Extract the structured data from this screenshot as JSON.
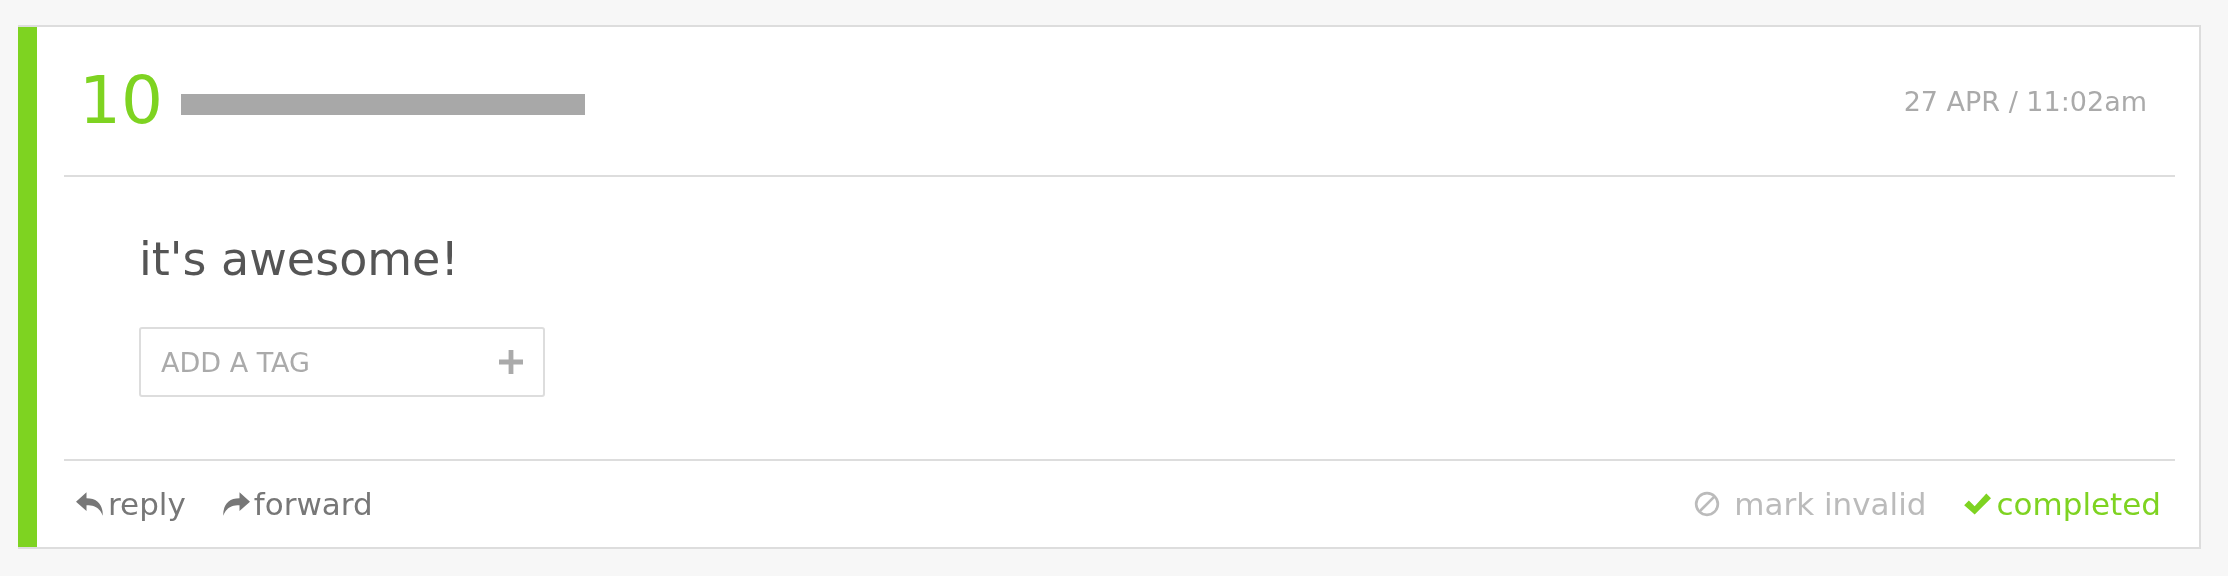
{
  "message": {
    "score": "10",
    "sender": {
      "redacted": true
    },
    "timestamp": "27 APR / 11:02am",
    "body": "it's awesome!",
    "tag_field": {
      "placeholder": "ADD A TAG"
    }
  },
  "actions": [
    {
      "kind": "reply",
      "label": "reply"
    },
    {
      "kind": "forward",
      "label": "forward"
    }
  ],
  "status_actions": [
    {
      "kind": "invalid",
      "label": "mark invalid",
      "selected": false
    },
    {
      "kind": "complete",
      "label": "completed",
      "selected": true
    }
  ]
}
